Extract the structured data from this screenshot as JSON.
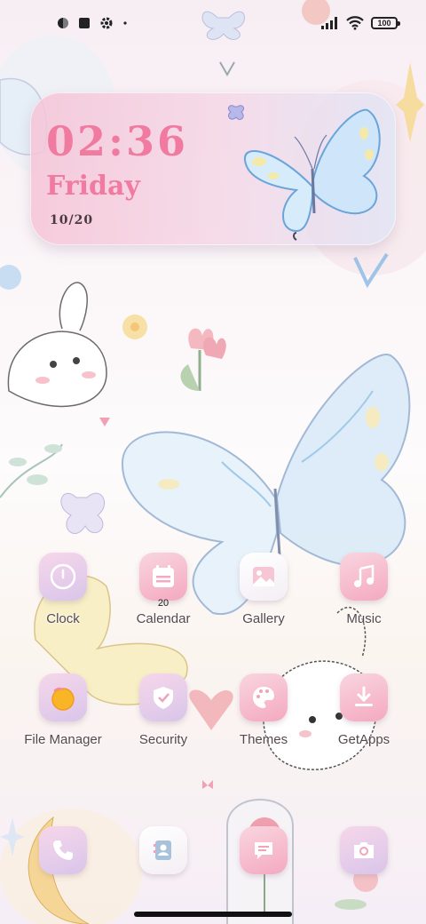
{
  "status_bar": {
    "icons": [
      "theme-icon",
      "square-notification-icon",
      "gear-icon",
      "dot-icon"
    ],
    "right_icons": [
      "signal-icon",
      "wifi-icon",
      "battery-icon"
    ],
    "battery": "100"
  },
  "clock_widget": {
    "time": "02:36",
    "day": "Friday",
    "date": "10/20",
    "accent": "#f07aa0"
  },
  "apps": [
    {
      "label": "Clock",
      "icon": "clock-icon"
    },
    {
      "label": "Calendar",
      "icon": "calendar-icon",
      "badge": "20"
    },
    {
      "label": "Gallery",
      "icon": "gallery-icon"
    },
    {
      "label": "Music",
      "icon": "music-icon"
    },
    {
      "label": "File Manager",
      "icon": "folder-icon"
    },
    {
      "label": "Security",
      "icon": "shield-icon"
    },
    {
      "label": "Themes",
      "icon": "palette-icon"
    },
    {
      "label": "GetApps",
      "icon": "download-icon"
    }
  ],
  "dock": [
    {
      "icon": "phone-icon"
    },
    {
      "icon": "contacts-icon"
    },
    {
      "icon": "messages-icon"
    },
    {
      "icon": "camera-icon"
    }
  ]
}
